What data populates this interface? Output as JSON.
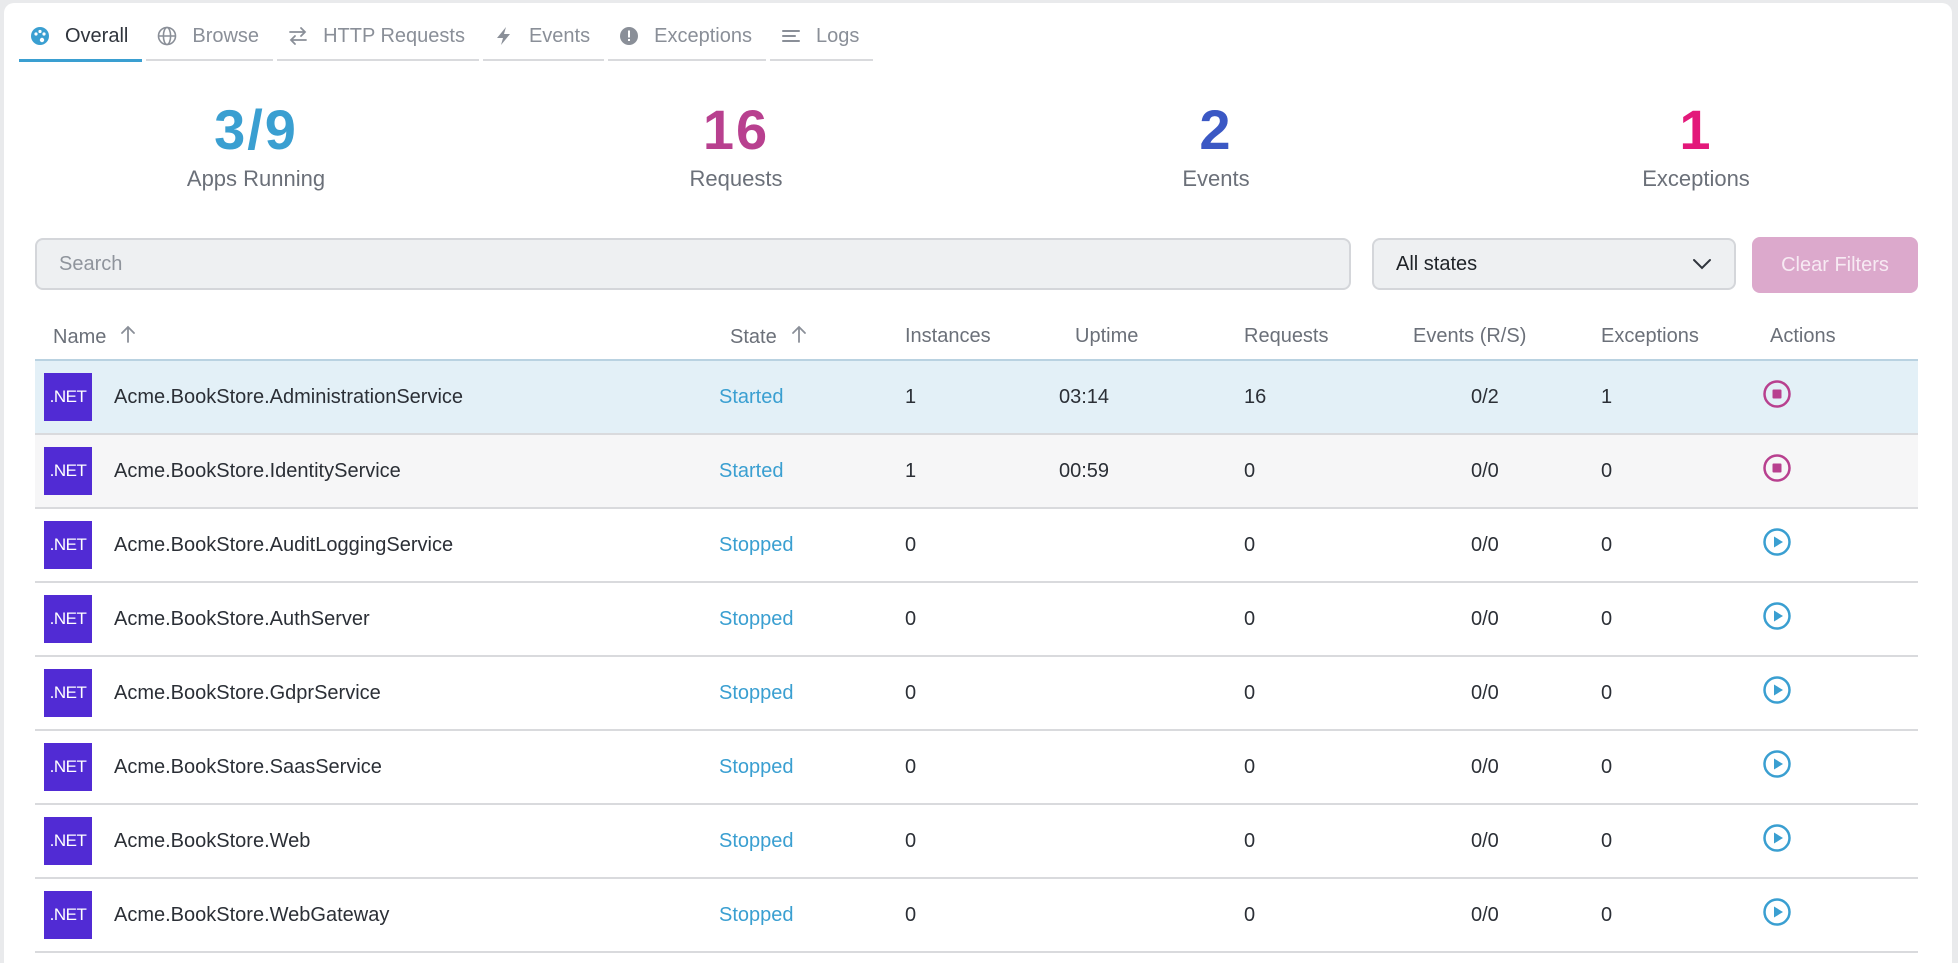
{
  "tabs": [
    {
      "label": "Overall",
      "icon": "palette-icon",
      "active": true
    },
    {
      "label": "Browse",
      "icon": "globe-icon"
    },
    {
      "label": "HTTP Requests",
      "icon": "arrows-exchange-icon"
    },
    {
      "label": "Events",
      "icon": "lightning-icon"
    },
    {
      "label": "Exceptions",
      "icon": "exclamation-circle-icon"
    },
    {
      "label": "Logs",
      "icon": "lines-icon"
    }
  ],
  "stats": {
    "apps": {
      "value": "3/9",
      "label": "Apps Running",
      "color": "#3a9fd1"
    },
    "requests": {
      "value": "16",
      "label": "Requests",
      "color": "#b8408f"
    },
    "events": {
      "value": "2",
      "label": "Events",
      "color": "#3b58c4"
    },
    "exceptions": {
      "value": "1",
      "label": "Exceptions",
      "color": "#e3187a"
    }
  },
  "filters": {
    "search_placeholder": "Search",
    "state_selected": "All states",
    "clear_label": "Clear Filters"
  },
  "table": {
    "columns": {
      "name": "Name",
      "state": "State",
      "instances": "Instances",
      "uptime": "Uptime",
      "requests": "Requests",
      "events": "Events (R/S)",
      "exceptions": "Exceptions",
      "actions": "Actions"
    },
    "logo_text": ".NET",
    "rows": [
      {
        "name": "Acme.BookStore.AdministrationService",
        "state": "Started",
        "instances": "1",
        "uptime": "03:14",
        "requests": "16",
        "events": "0/2",
        "exceptions": "1",
        "action": "stop-icon"
      },
      {
        "name": "Acme.BookStore.IdentityService",
        "state": "Started",
        "instances": "1",
        "uptime": "00:59",
        "requests": "0",
        "events": "0/0",
        "exceptions": "0",
        "action": "stop-icon"
      },
      {
        "name": "Acme.BookStore.AuditLoggingService",
        "state": "Stopped",
        "instances": "0",
        "uptime": "",
        "requests": "0",
        "events": "0/0",
        "exceptions": "0",
        "action": "play-icon"
      },
      {
        "name": "Acme.BookStore.AuthServer",
        "state": "Stopped",
        "instances": "0",
        "uptime": "",
        "requests": "0",
        "events": "0/0",
        "exceptions": "0",
        "action": "play-icon"
      },
      {
        "name": "Acme.BookStore.GdprService",
        "state": "Stopped",
        "instances": "0",
        "uptime": "",
        "requests": "0",
        "events": "0/0",
        "exceptions": "0",
        "action": "play-icon"
      },
      {
        "name": "Acme.BookStore.SaasService",
        "state": "Stopped",
        "instances": "0",
        "uptime": "",
        "requests": "0",
        "events": "0/0",
        "exceptions": "0",
        "action": "play-icon"
      },
      {
        "name": "Acme.BookStore.Web",
        "state": "Stopped",
        "instances": "0",
        "uptime": "",
        "requests": "0",
        "events": "0/0",
        "exceptions": "0",
        "action": "play-icon"
      },
      {
        "name": "Acme.BookStore.WebGateway",
        "state": "Stopped",
        "instances": "0",
        "uptime": "",
        "requests": "0",
        "events": "0/0",
        "exceptions": "0",
        "action": "play-icon"
      }
    ]
  },
  "colors": {
    "accent": "#3a9fd1",
    "stop": "#b8408f",
    "dotnet": "#512bd4"
  }
}
